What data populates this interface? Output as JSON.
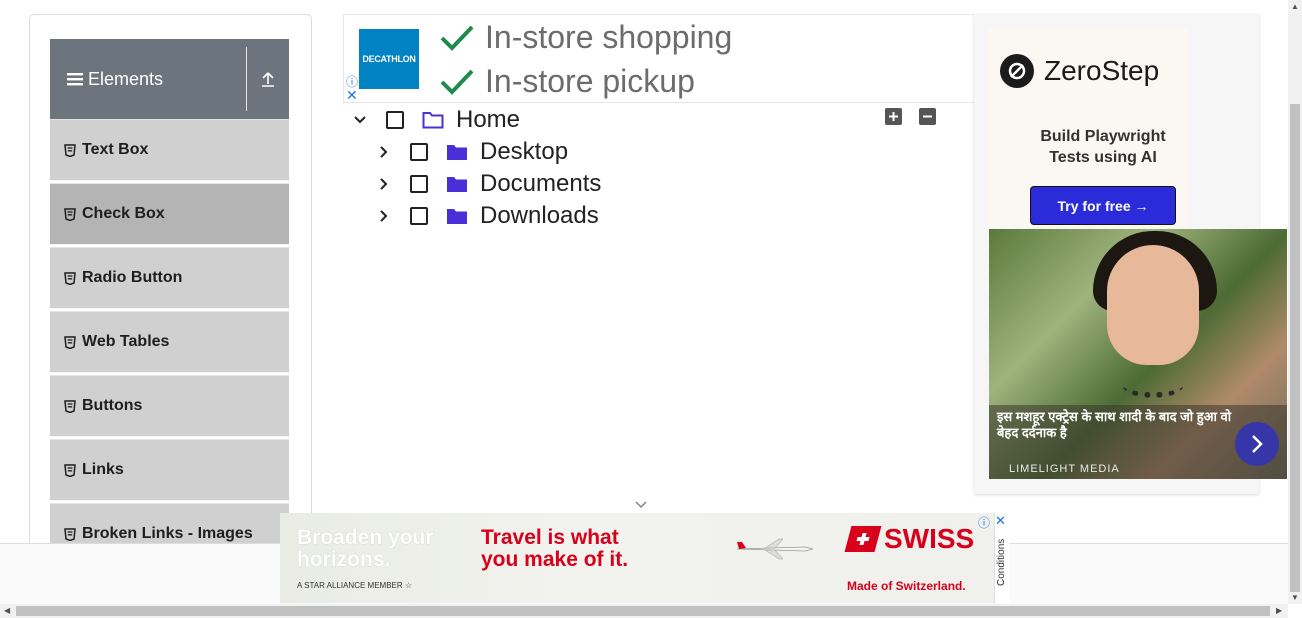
{
  "sidebar": {
    "group_title": "Elements",
    "items": [
      {
        "label": "Text Box",
        "active": false
      },
      {
        "label": "Check Box",
        "active": true
      },
      {
        "label": "Radio Button",
        "active": false
      },
      {
        "label": "Web Tables",
        "active": false
      },
      {
        "label": "Buttons",
        "active": false
      },
      {
        "label": "Links",
        "active": false
      },
      {
        "label": "Broken Links - Images",
        "active": false
      }
    ]
  },
  "top_ad": {
    "brand": "DECATHLON",
    "line1": "In-store shopping",
    "line2": "In-store pickup"
  },
  "tree": {
    "root": {
      "label": "Home",
      "expanded": true,
      "checked": false
    },
    "children": [
      {
        "label": "Desktop",
        "expanded": false,
        "checked": false
      },
      {
        "label": "Documents",
        "expanded": false,
        "checked": false
      },
      {
        "label": "Downloads",
        "expanded": false,
        "checked": false
      }
    ]
  },
  "right_ad": {
    "brand": "ZeroStep",
    "tagline_1": "Build Playwright",
    "tagline_2": "Tests using AI",
    "cta": "Try for free →",
    "photo_caption": "इस मशहूर एक्ट्रेस के साथ शादी के बाद जो हुआ वो बेहद दर्दनाक है",
    "photo_source": "LIMELIGHT MEDIA"
  },
  "bottom_ad": {
    "left_line1": "Broaden your",
    "left_line2": "horizons.",
    "star_alliance": "A STAR ALLIANCE MEMBER",
    "mid_line1": "Travel is what",
    "mid_line2": "you make of it.",
    "brand": "SWISS",
    "made": "Made of Switzerland.",
    "conditions": "Conditions"
  },
  "colors": {
    "sidebar_header": "#6c757d",
    "menu_item": "#d0d0d0",
    "menu_item_active": "#b4b4b4",
    "folder": "#4b2fd6",
    "zerostep_cta": "#2b2bd9",
    "swiss_red": "#d9001b"
  }
}
